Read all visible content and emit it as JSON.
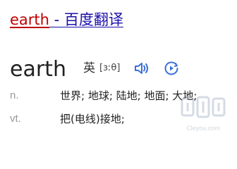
{
  "result_title": {
    "keyword": "earth",
    "separator": " - ",
    "site": "百度翻译"
  },
  "entry": {
    "headword": "earth",
    "pronunciation": {
      "lang": "英",
      "ipa": "[ɜːθ]"
    },
    "definitions": [
      {
        "pos": "n.",
        "meaning": "世界; 地球; 陆地; 地面; 大地;"
      },
      {
        "pos": "vt.",
        "meaning": "把(电线)接地;"
      }
    ]
  },
  "icons": {
    "speaker": "speaker-icon",
    "play": "play-circle-icon"
  },
  "watermark": {
    "text": "Cleyou.com"
  },
  "colors": {
    "link": "#1a0dab",
    "highlight": "#c00000",
    "accent": "#3b6fd8",
    "muted": "#999999"
  }
}
